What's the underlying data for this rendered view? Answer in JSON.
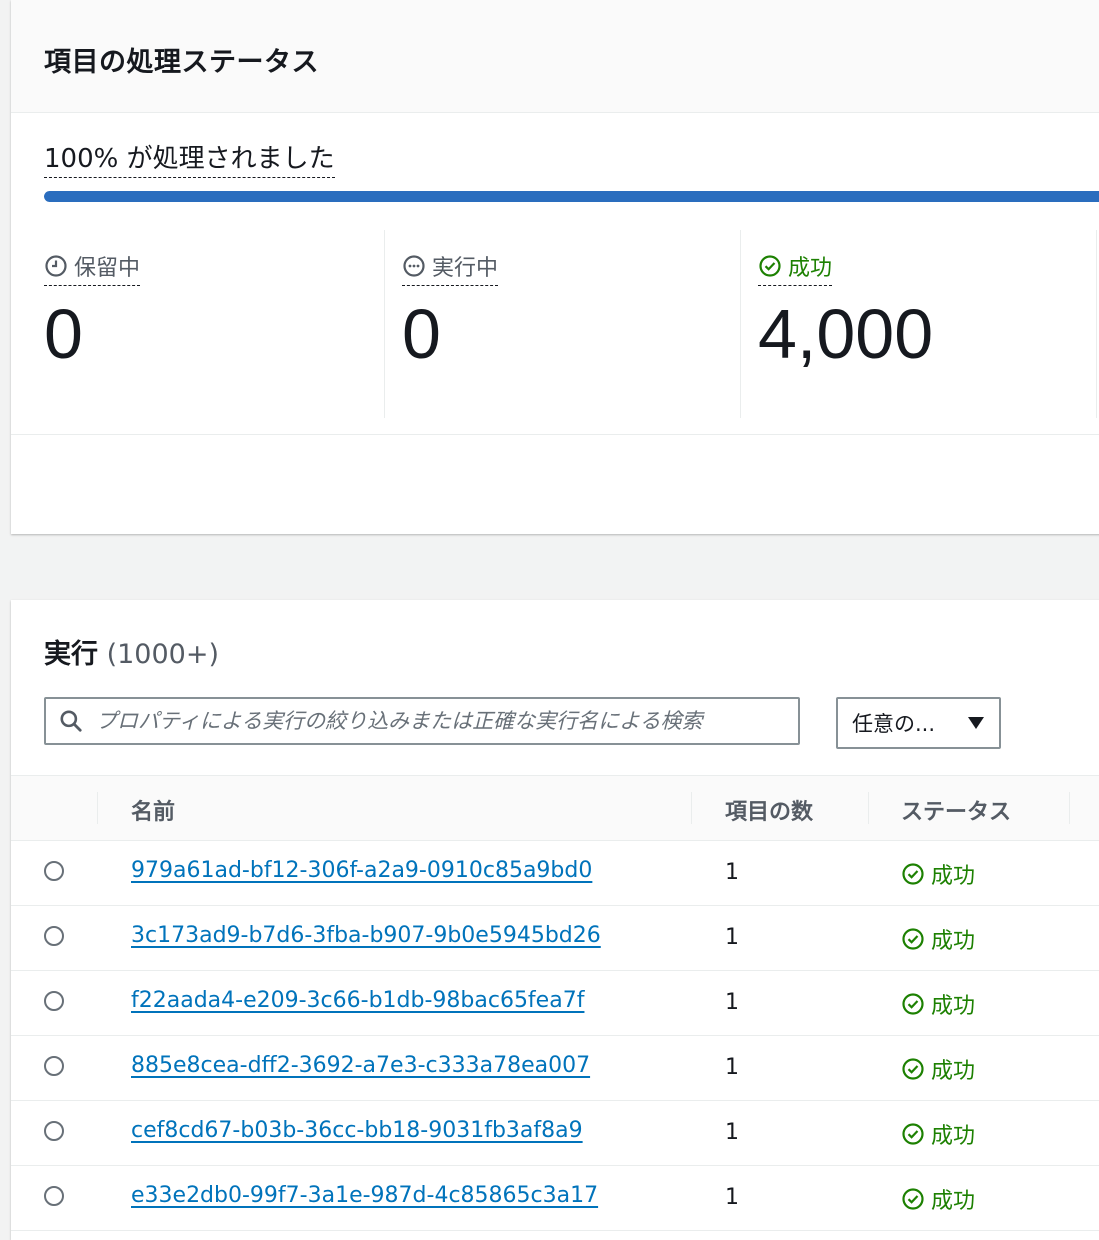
{
  "status_panel": {
    "title": "項目の処理ステータス",
    "progress": {
      "label": "100% が処理されました",
      "percent": 100
    },
    "metrics": [
      {
        "label": "保留中",
        "value": "0",
        "icon": "clock-icon"
      },
      {
        "label": "実行中",
        "value": "0",
        "icon": "ellipsis-circle-icon"
      },
      {
        "label": "成功",
        "value": "4,000",
        "icon": "check-circle-icon"
      }
    ]
  },
  "executions": {
    "title": "実行",
    "count": "(1000+)",
    "search": {
      "placeholder": "プロパティによる実行の絞り込みまたは正確な実行名による検索",
      "value": ""
    },
    "filter": {
      "selected": "任意の..."
    },
    "columns": {
      "name": "名前",
      "item_count": "項目の数",
      "status": "ステータス"
    },
    "rows": [
      {
        "name": "979a61ad-bf12-306f-a2a9-0910c85a9bd0",
        "item_count": "1",
        "status": "成功"
      },
      {
        "name": "3c173ad9-b7d6-3fba-b907-9b0e5945bd26",
        "item_count": "1",
        "status": "成功"
      },
      {
        "name": "f22aada4-e209-3c66-b1db-98bac65fea7f",
        "item_count": "1",
        "status": "成功"
      },
      {
        "name": "885e8cea-dff2-3692-a7e3-c333a78ea007",
        "item_count": "1",
        "status": "成功"
      },
      {
        "name": "cef8cd67-b03b-36cc-bb18-9031fb3af8a9",
        "item_count": "1",
        "status": "成功"
      },
      {
        "name": "e33e2db0-99f7-3a1e-987d-4c85865c3a17",
        "item_count": "1",
        "status": "成功"
      }
    ]
  },
  "colors": {
    "link": "#0073bb",
    "success": "#1d8102",
    "progress": "#2a6dbe"
  }
}
